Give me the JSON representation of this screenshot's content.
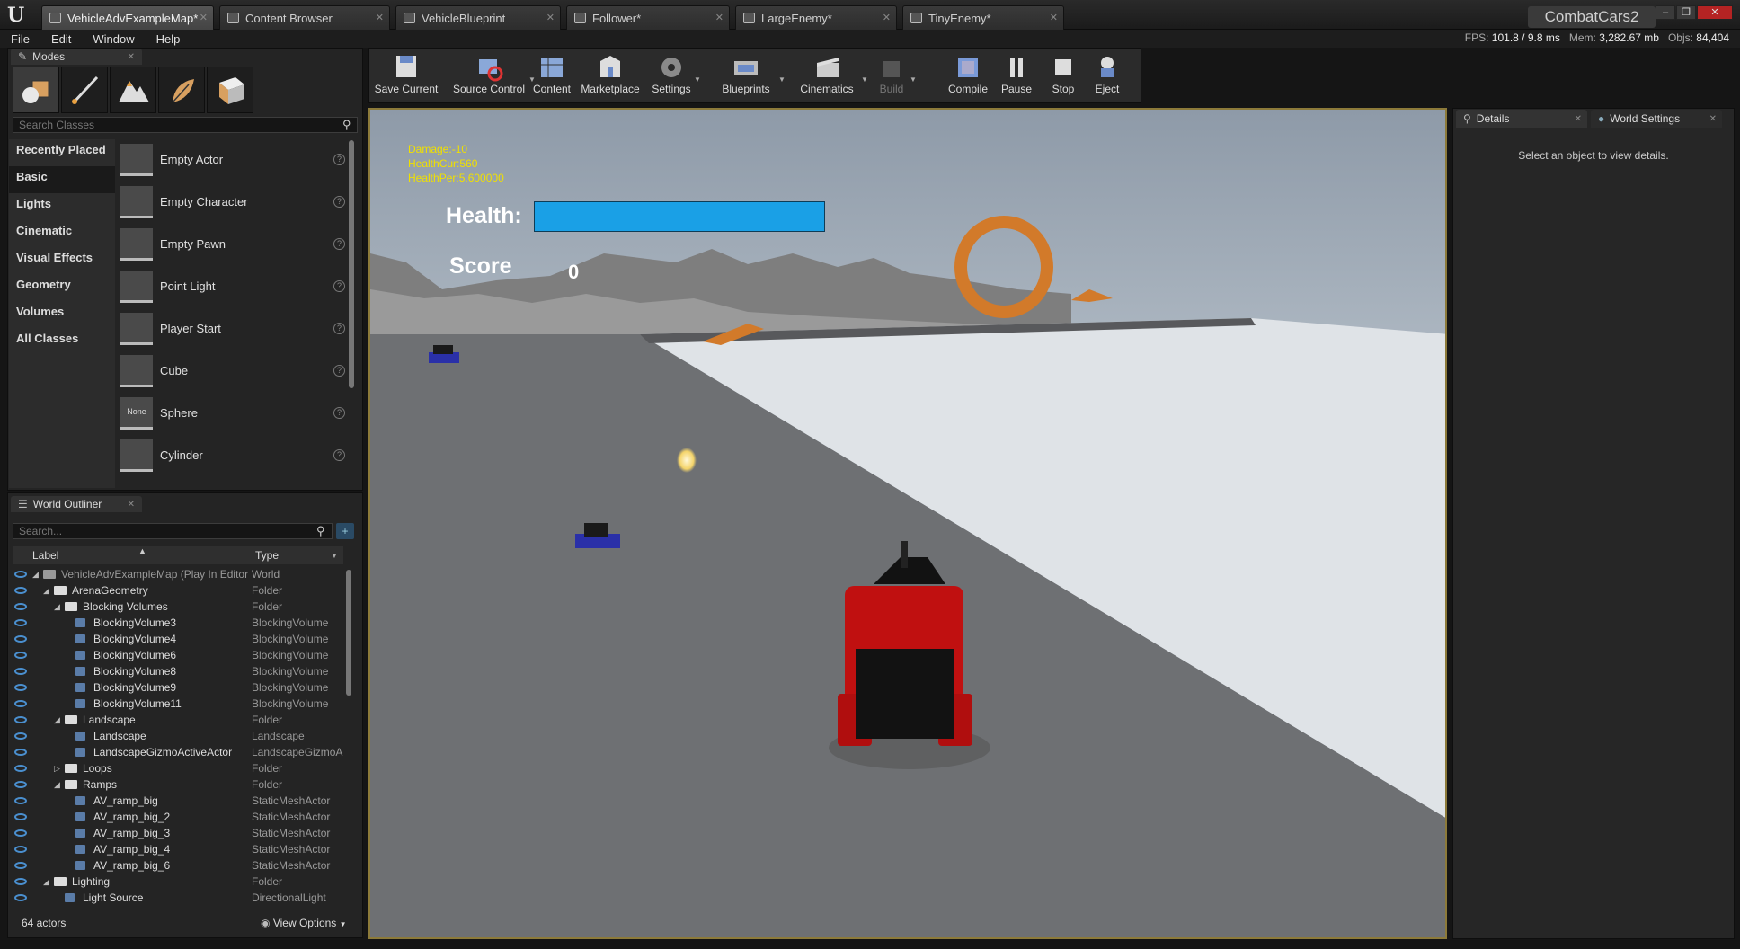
{
  "window": {
    "tabs": [
      {
        "label": "VehicleAdvExampleMap*",
        "active": true
      },
      {
        "label": "Content Browser",
        "active": false
      },
      {
        "label": "VehicleBlueprint",
        "active": false
      },
      {
        "label": "Follower*",
        "active": false
      },
      {
        "label": "LargeEnemy*",
        "active": false
      },
      {
        "label": "TinyEnemy*",
        "active": false
      }
    ],
    "project_name": "CombatCars2",
    "controls": {
      "minimize": "–",
      "restore": "❐",
      "close": "✕"
    }
  },
  "menu": [
    "File",
    "Edit",
    "Window",
    "Help"
  ],
  "stats": {
    "fps_label": "FPS:",
    "fps": "101.8 / 9.8 ms",
    "mem_label": "Mem:",
    "mem": "3,282.67 mb",
    "objs_label": "Objs:",
    "objs": "84,404"
  },
  "modes": {
    "tab_label": "Modes",
    "search_placeholder": "Search Classes",
    "categories": [
      "Recently Placed",
      "Basic",
      "Lights",
      "Cinematic",
      "Visual Effects",
      "Geometry",
      "Volumes",
      "All Classes"
    ],
    "active_category": "Basic",
    "classes": [
      {
        "name": "Empty Actor",
        "icon": "sphere-white-icon"
      },
      {
        "name": "Empty Character",
        "icon": "character-icon"
      },
      {
        "name": "Empty Pawn",
        "icon": "pawn-icon"
      },
      {
        "name": "Point Light",
        "icon": "light-bulb-icon"
      },
      {
        "name": "Player Start",
        "icon": "player-start-icon"
      },
      {
        "name": "Cube",
        "icon": "cube-icon"
      },
      {
        "name": "Sphere",
        "icon": "none-thumb",
        "thumb_text": "None"
      },
      {
        "name": "Cylinder",
        "icon": "cylinder-icon"
      }
    ],
    "help_glyph": "?"
  },
  "outliner": {
    "tab_label": "World Outliner",
    "search_placeholder": "Search...",
    "col_label": "Label",
    "col_type": "Type",
    "rows": [
      {
        "label": "VehicleAdvExampleMap (Play In Editor",
        "type": "World",
        "depth": 0,
        "kind": "world",
        "tri": "◢"
      },
      {
        "label": "ArenaGeometry",
        "type": "Folder",
        "depth": 1,
        "kind": "folder",
        "tri": "◢"
      },
      {
        "label": "Blocking Volumes",
        "type": "Folder",
        "depth": 2,
        "kind": "folder",
        "tri": "◢"
      },
      {
        "label": "BlockingVolume3",
        "type": "BlockingVolume",
        "depth": 3,
        "kind": "actor"
      },
      {
        "label": "BlockingVolume4",
        "type": "BlockingVolume",
        "depth": 3,
        "kind": "actor"
      },
      {
        "label": "BlockingVolume6",
        "type": "BlockingVolume",
        "depth": 3,
        "kind": "actor"
      },
      {
        "label": "BlockingVolume8",
        "type": "BlockingVolume",
        "depth": 3,
        "kind": "actor"
      },
      {
        "label": "BlockingVolume9",
        "type": "BlockingVolume",
        "depth": 3,
        "kind": "actor"
      },
      {
        "label": "BlockingVolume11",
        "type": "BlockingVolume",
        "depth": 3,
        "kind": "actor"
      },
      {
        "label": "Landscape",
        "type": "Folder",
        "depth": 2,
        "kind": "folder",
        "tri": "◢"
      },
      {
        "label": "Landscape",
        "type": "Landscape",
        "depth": 3,
        "kind": "actor"
      },
      {
        "label": "LandscapeGizmoActiveActor",
        "type": "LandscapeGizmoA",
        "depth": 3,
        "kind": "actor"
      },
      {
        "label": "Loops",
        "type": "Folder",
        "depth": 2,
        "kind": "folder",
        "tri": "▷"
      },
      {
        "label": "Ramps",
        "type": "Folder",
        "depth": 2,
        "kind": "folder",
        "tri": "◢"
      },
      {
        "label": "AV_ramp_big",
        "type": "StaticMeshActor",
        "depth": 3,
        "kind": "actor"
      },
      {
        "label": "AV_ramp_big_2",
        "type": "StaticMeshActor",
        "depth": 3,
        "kind": "actor"
      },
      {
        "label": "AV_ramp_big_3",
        "type": "StaticMeshActor",
        "depth": 3,
        "kind": "actor"
      },
      {
        "label": "AV_ramp_big_4",
        "type": "StaticMeshActor",
        "depth": 3,
        "kind": "actor"
      },
      {
        "label": "AV_ramp_big_6",
        "type": "StaticMeshActor",
        "depth": 3,
        "kind": "actor"
      },
      {
        "label": "Lighting",
        "type": "Folder",
        "depth": 1,
        "kind": "folder",
        "tri": "◢"
      },
      {
        "label": "Light Source",
        "type": "DirectionalLight",
        "depth": 2,
        "kind": "actor"
      }
    ],
    "actor_count": "64 actors",
    "view_options": "View Options"
  },
  "toolbar": {
    "buttons": [
      {
        "label": "Save Current",
        "icon": "save-icon"
      },
      {
        "label": "Source Control",
        "icon": "source-control-icon",
        "dropdown": true
      },
      {
        "label": "Content",
        "icon": "content-icon"
      },
      {
        "label": "Marketplace",
        "icon": "marketplace-icon"
      },
      {
        "label": "Settings",
        "icon": "settings-icon",
        "dropdown": true
      },
      {
        "label": "Blueprints",
        "icon": "blueprints-icon",
        "dropdown": true
      },
      {
        "label": "Cinematics",
        "icon": "cinematics-icon",
        "dropdown": true
      },
      {
        "label": "Build",
        "icon": "build-icon",
        "dropdown": true,
        "disabled": true
      },
      {
        "label": "Compile",
        "icon": "compile-icon"
      },
      {
        "label": "Pause",
        "icon": "pause-icon"
      },
      {
        "label": "Stop",
        "icon": "stop-icon"
      },
      {
        "label": "Eject",
        "icon": "eject-icon"
      }
    ]
  },
  "viewport": {
    "hud": {
      "damage": "Damage:-10",
      "health_cur": "HealthCur:560",
      "health_per": "HealthPer:5.600000",
      "health_label": "Health:",
      "health_fraction": 1.0,
      "score_label": "Score",
      "score_value": "0"
    }
  },
  "details": {
    "tabs": [
      "Details",
      "World Settings"
    ],
    "hint": "Select an object to view details."
  },
  "colors": {
    "accent_blue": "#1aa0e6",
    "hud_text_yellow": "#f0e000",
    "viewport_border": "#8c7a3a",
    "close_red": "#b42323"
  }
}
